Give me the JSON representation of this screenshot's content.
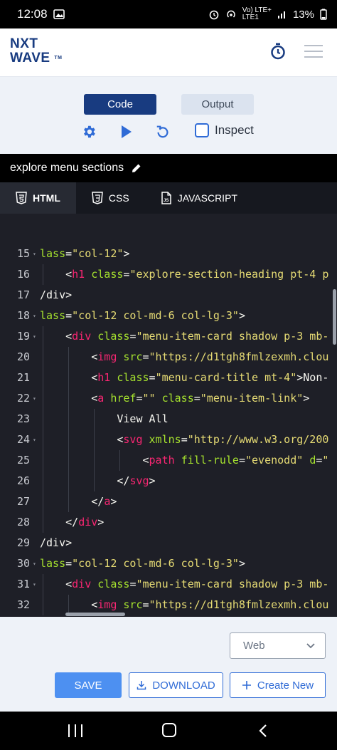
{
  "status_bar": {
    "time": "12:08",
    "network": "Vo) LTE+",
    "network_sub": "LTE1",
    "battery": "13%",
    "icons": [
      "image-icon",
      "alarm-icon",
      "hotspot-icon",
      "signal-icon",
      "battery-icon"
    ]
  },
  "header": {
    "logo_line1": "NXT",
    "logo_line2": "WAVE",
    "logo_tm": "TM",
    "icons": [
      "timer-icon",
      "hamburger-menu-icon"
    ]
  },
  "controls": {
    "code_label": "Code",
    "output_label": "Output",
    "inspect_label": "Inspect",
    "icons": [
      "gear-icon",
      "play-icon",
      "reset-icon"
    ]
  },
  "title_bar": {
    "title": "explore menu sections",
    "icon": "pencil-icon"
  },
  "tabs": [
    {
      "label": "HTML",
      "icon": "html5-icon",
      "active": true
    },
    {
      "label": "CSS",
      "icon": "css3-icon",
      "active": false
    },
    {
      "label": "JAVASCRIPT",
      "icon": "js-file-icon",
      "active": false
    }
  ],
  "editor": {
    "lines": [
      {
        "num": "15",
        "fold": true,
        "text": "lass=\"col-12\">"
      },
      {
        "num": "16",
        "fold": false,
        "text": "  <h1 class=\"explore-section-heading pt-4 p"
      },
      {
        "num": "17",
        "fold": false,
        "text": "/div>"
      },
      {
        "num": "18",
        "fold": true,
        "text": "lass=\"col-12 col-md-6 col-lg-3\">"
      },
      {
        "num": "19",
        "fold": true,
        "text": "  <div class=\"menu-item-card shadow p-3 mb-"
      },
      {
        "num": "20",
        "fold": false,
        "text": "    <img src=\"https://d1tgh8fmlzexmh.clou"
      },
      {
        "num": "21",
        "fold": false,
        "text": "    <h1 class=\"menu-card-title mt-4\">Non-"
      },
      {
        "num": "22",
        "fold": true,
        "text": "    <a href=\"\" class=\"menu-item-link\">"
      },
      {
        "num": "23",
        "fold": false,
        "text": "      View All"
      },
      {
        "num": "24",
        "fold": true,
        "text": "      <svg xmlns=\"http://www.w3.org/200"
      },
      {
        "num": "25",
        "fold": false,
        "text": "        <path fill-rule=\"evenodd\" d=\""
      },
      {
        "num": "26",
        "fold": false,
        "text": "      </svg>"
      },
      {
        "num": "27",
        "fold": false,
        "text": "    </a>"
      },
      {
        "num": "28",
        "fold": false,
        "text": "  </div>"
      },
      {
        "num": "29",
        "fold": false,
        "text": "/div>"
      },
      {
        "num": "30",
        "fold": true,
        "text": "lass=\"col-12 col-md-6 col-lg-3\">"
      },
      {
        "num": "31",
        "fold": true,
        "text": "  <div class=\"menu-item-card shadow p-3 mb-"
      },
      {
        "num": "32",
        "fold": false,
        "text": "    <img src=\"https://d1tgh8fmlzexmh.clou"
      }
    ]
  },
  "bottom": {
    "select_value": "Web",
    "save_label": "SAVE",
    "download_label": "DOWNLOAD",
    "create_label": "Create New"
  },
  "colors": {
    "brand": "#183b80",
    "accent": "#2f6bd6",
    "save": "#4d90f1",
    "tag": "#f92672",
    "attr": "#a6e22e",
    "string": "#e6db74"
  }
}
